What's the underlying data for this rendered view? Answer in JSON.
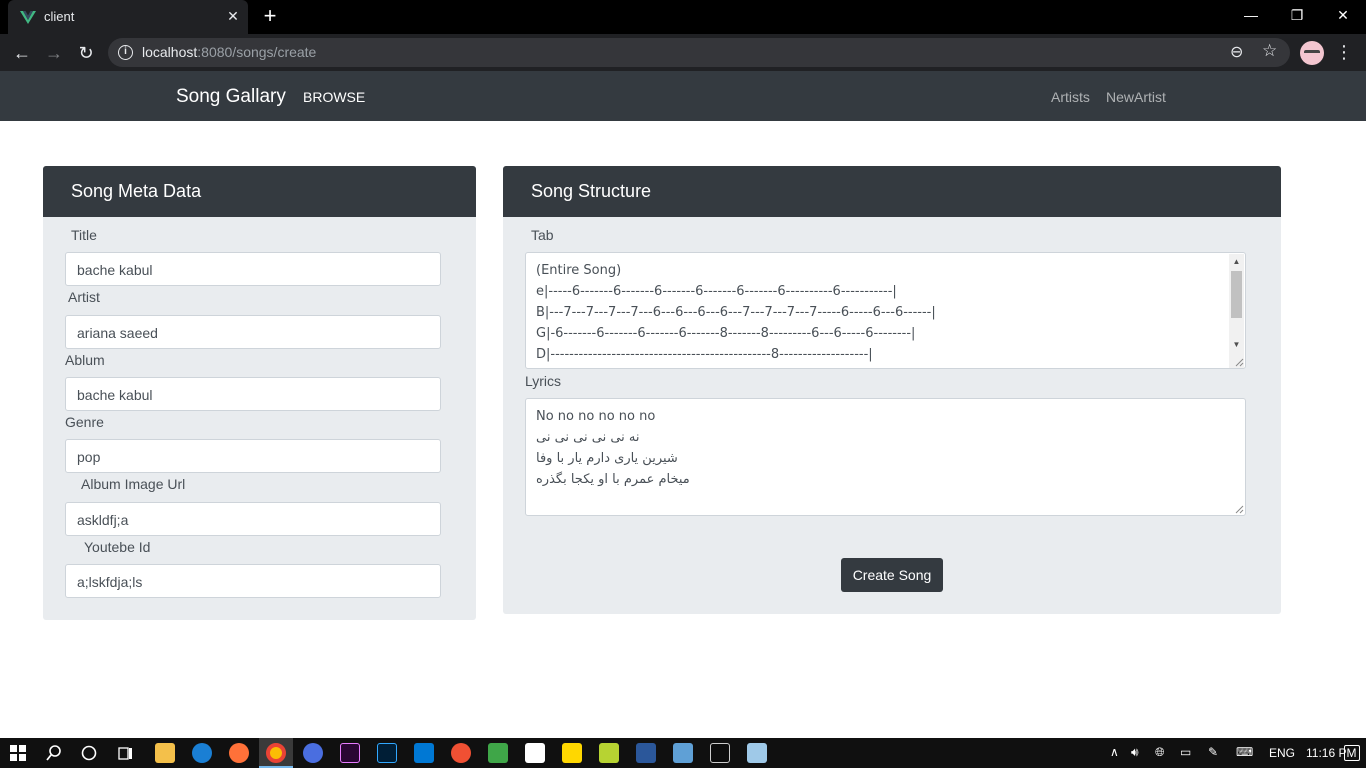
{
  "browser": {
    "tab_title": "client",
    "url_host": "localhost",
    "url_rest": ":8080/songs/create",
    "new_tab": "+",
    "tab_close": "✕"
  },
  "navbar": {
    "brand": "Song Gallary",
    "browse": "BROWSE",
    "artists": "Artists",
    "new_artist": "NewArtist"
  },
  "meta_panel": {
    "title": "Song Meta Data",
    "fields": [
      {
        "label": "Title",
        "value": "bache kabul"
      },
      {
        "label": "Artist",
        "value": "ariana saeed"
      },
      {
        "label": "Ablum",
        "value": "bache kabul"
      },
      {
        "label": "Genre",
        "value": "pop"
      },
      {
        "label": "Album Image Url",
        "value": "askldfj;a"
      },
      {
        "label": "Youtebe Id",
        "value": "a;lskfdja;ls"
      }
    ]
  },
  "structure_panel": {
    "title": "Song Structure",
    "tab_label": "Tab",
    "tab_lines": [
      "(Entire Song)",
      "e|-----6-------6-------6-------6-------6-------6----------6-----------|",
      "B|---7---7---7---7---6---6---6---6---7---7---7---7-----6-----6---6------|",
      "G|-6-------6-------6-------6-------8-------8---------6---6-----6--------|",
      "D|-----------------------------------------------8-------------------|"
    ],
    "lyrics_label": "Lyrics",
    "lyrics_lines": [
      "No no no no no no",
      "نه نی نی نی نی نی",
      "شیرین یاری دارم یار با وفا",
      "میخام عمرم با او یکجا بگذره"
    ],
    "submit": "Create Song"
  },
  "taskbar": {
    "lang": "ENG",
    "time": "11:16 PM"
  }
}
